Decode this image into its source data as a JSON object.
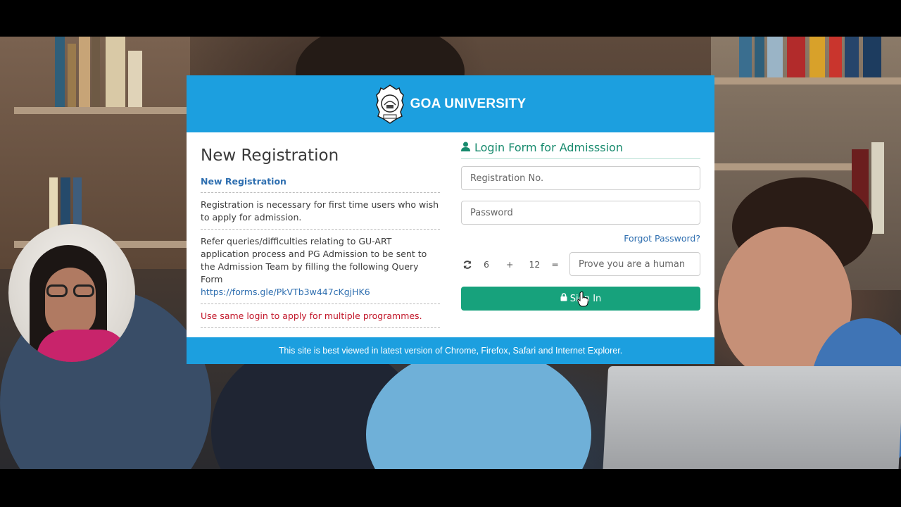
{
  "header": {
    "brand": "GOA UNIVERSITY",
    "logo_icon": "goa-university-seal"
  },
  "left": {
    "title": "New Registration",
    "new_registration_link": "New Registration",
    "registration_note": "Registration is necessary for first time users who wish to apply for admission.",
    "query_text": "Refer queries/difficulties relating to GU-ART application process and PG Admission to be sent to the Admission Team by filling the following Query Form",
    "query_link": "https://forms.gle/PkVTb3w447cKgjHK6",
    "warning": "Use same login to apply for multiple programmes."
  },
  "login": {
    "title": "Login Form for Admisssion",
    "title_icon": "user-icon",
    "registration_placeholder": "Registration No.",
    "password_placeholder": "Password",
    "forgot_password": "Forgot Password?",
    "captcha": {
      "a": "6",
      "op": "+",
      "b": "12",
      "eq": "=",
      "placeholder": "Prove you are a human",
      "refresh_icon": "refresh-icon"
    },
    "signin_label": "Sign In",
    "signin_icon": "lock-icon"
  },
  "footer": {
    "text": "This site is best viewed in latest version of Chrome, Firefox, Safari and Internet Explorer."
  },
  "colors": {
    "primary": "#1c9fdf",
    "accent_green": "#17a27c",
    "link": "#2f6fb0",
    "warning": "#c2172a"
  }
}
